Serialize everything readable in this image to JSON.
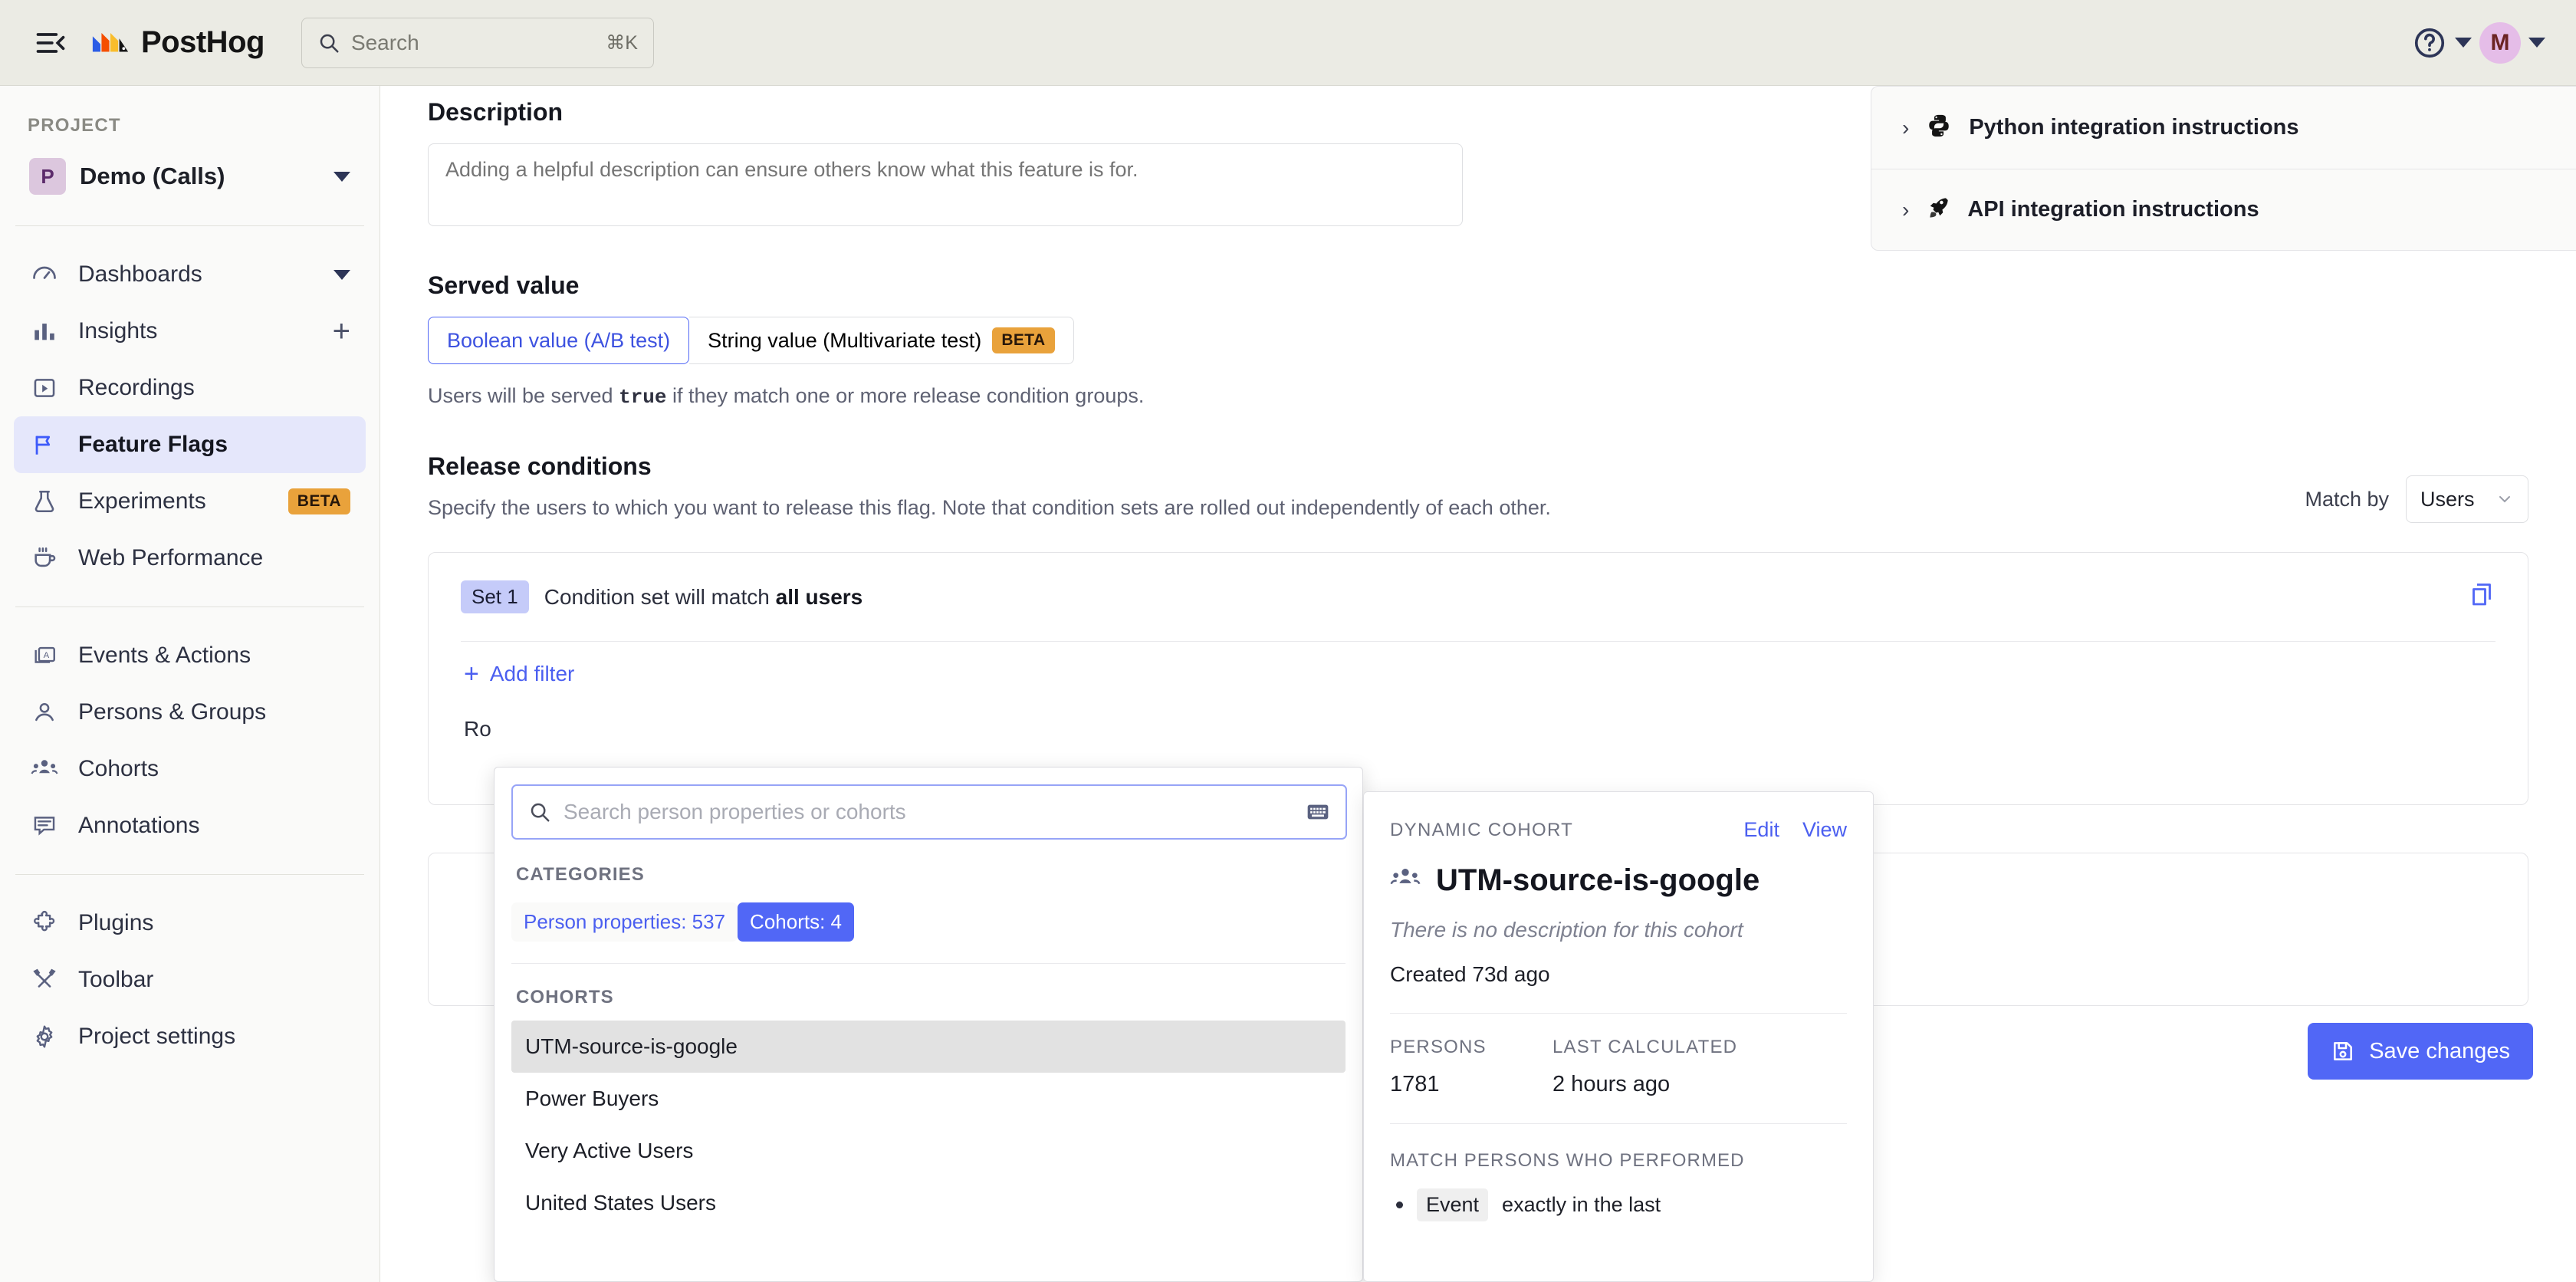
{
  "topbar": {
    "menu_icon": "hamburger-collapse-icon",
    "brand": "PostHog",
    "search_placeholder": "Search",
    "search_shortcut": "⌘K",
    "help_icon": "question-circle-icon",
    "avatar_initial": "M"
  },
  "sidebar": {
    "section_label": "PROJECT",
    "project": {
      "badge": "P",
      "name": "Demo (Calls)"
    },
    "items": [
      {
        "label": "Dashboards",
        "icon": "gauge-icon",
        "trailing": "caret",
        "active": false
      },
      {
        "label": "Insights",
        "icon": "bar-chart-icon",
        "trailing": "plus",
        "active": false
      },
      {
        "label": "Recordings",
        "icon": "play-square-icon",
        "trailing": "",
        "active": false
      },
      {
        "label": "Feature Flags",
        "icon": "flag-icon",
        "trailing": "",
        "active": true
      },
      {
        "label": "Experiments",
        "icon": "flask-icon",
        "trailing": "beta",
        "active": false
      },
      {
        "label": "Web Performance",
        "icon": "coffee-cup-icon",
        "trailing": "",
        "active": false
      },
      {
        "label": "Events & Actions",
        "icon": "events-icon",
        "trailing": "",
        "active": false
      },
      {
        "label": "Persons & Groups",
        "icon": "person-icon",
        "trailing": "",
        "active": false
      },
      {
        "label": "Cohorts",
        "icon": "people-group-icon",
        "trailing": "",
        "active": false
      },
      {
        "label": "Annotations",
        "icon": "comment-lines-icon",
        "trailing": "",
        "active": false
      },
      {
        "label": "Plugins",
        "icon": "puzzle-icon",
        "trailing": "",
        "active": false
      },
      {
        "label": "Toolbar",
        "icon": "tools-icon",
        "trailing": "",
        "active": false
      },
      {
        "label": "Project settings",
        "icon": "gear-icon",
        "trailing": "",
        "active": false
      }
    ],
    "beta_badge": "BETA"
  },
  "main": {
    "description": {
      "title": "Description",
      "placeholder": "Adding a helpful description can ensure others know what this feature is for.",
      "value": ""
    },
    "served_value": {
      "title": "Served value",
      "option_boolean": "Boolean value (A/B test)",
      "option_string": "String value (Multivariate test)",
      "string_badge": "BETA",
      "selected": "Boolean value (A/B test)",
      "note_prefix": "Users will be served",
      "note_code": "true",
      "note_suffix": "if they match one or more release condition groups."
    },
    "release_conditions": {
      "title": "Release conditions",
      "description": "Specify the users to which you want to release this flag. Note that condition sets are rolled out independently of each other.",
      "match_by_label": "Match by",
      "match_by_value": "Users",
      "set_pill": "Set 1",
      "set_text_prefix": "Condition set will match",
      "set_text_bold": "all users",
      "add_filter": "Add filter",
      "rollout_partial": "Ro"
    },
    "save_button": "Save changes",
    "save_icon": "floppy-disk-icon"
  },
  "integration_panel": {
    "rows": [
      {
        "label": "Python integration instructions",
        "icon": "python-icon"
      },
      {
        "label": "API integration instructions",
        "icon": "api-rocket-icon"
      }
    ]
  },
  "property_popover": {
    "search_placeholder": "Search person properties or cohorts",
    "search_icon": "search-icon",
    "keyboard_icon": "keyboard-icon",
    "categories_label": "CATEGORIES",
    "chips": [
      {
        "label": "Person properties: 537",
        "selected": false
      },
      {
        "label": "Cohorts: 4",
        "selected": true
      }
    ],
    "cohorts_label": "COHORTS",
    "cohorts": [
      {
        "label": "UTM-source-is-google",
        "highlighted": true
      },
      {
        "label": "Power Buyers",
        "highlighted": false
      },
      {
        "label": "Very Active Users",
        "highlighted": false
      },
      {
        "label": "United States Users",
        "highlighted": false
      }
    ]
  },
  "cohort_detail": {
    "kicker": "DYNAMIC COHORT",
    "edit": "Edit",
    "view": "View",
    "icon": "people-group-icon",
    "title": "UTM-source-is-google",
    "description": "There is no description for this cohort",
    "created": "Created 73d ago",
    "persons_label": "PERSONS",
    "persons_value": "1781",
    "last_calculated_label": "LAST CALCULATED",
    "last_calculated_value": "2 hours ago",
    "match_label": "MATCH PERSONS WHO PERFORMED",
    "match_tag": "Event",
    "match_rest": "exactly in the last"
  },
  "colors": {
    "accent": "#5167F6",
    "accent_link": "#4b5ff0",
    "topbar_bg": "#EBEBE4",
    "sidebar_bg": "#FAFAF9",
    "active_nav_bg": "#E5E7FB",
    "beta": "#E9A23B",
    "highlight_row": "#E2E2E2"
  }
}
